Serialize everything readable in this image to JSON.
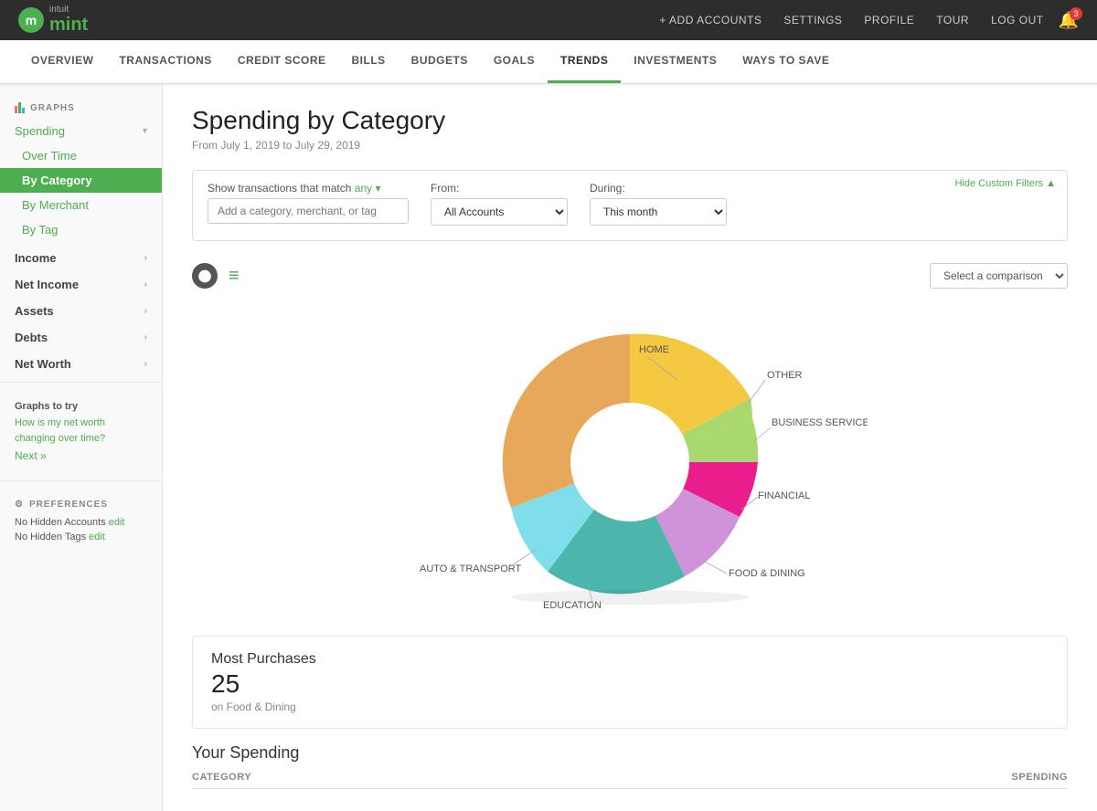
{
  "app": {
    "logo_intuit": "intuit",
    "logo_mint": "mint",
    "bell_count": "3"
  },
  "top_nav": {
    "add_accounts": "+ ADD ACCOUNTS",
    "settings": "SETTINGS",
    "profile": "PROFILE",
    "tour": "TOUR",
    "log_out": "LOG OUT"
  },
  "second_nav": {
    "items": [
      {
        "label": "OVERVIEW",
        "active": false
      },
      {
        "label": "TRANSACTIONS",
        "active": false
      },
      {
        "label": "CREDIT SCORE",
        "active": false
      },
      {
        "label": "BILLS",
        "active": false
      },
      {
        "label": "BUDGETS",
        "active": false
      },
      {
        "label": "GOALS",
        "active": false
      },
      {
        "label": "TRENDS",
        "active": true
      },
      {
        "label": "INVESTMENTS",
        "active": false
      },
      {
        "label": "WAYS TO SAVE",
        "active": false
      }
    ]
  },
  "sidebar": {
    "graphs_label": "GRAPHS",
    "spending_label": "Spending",
    "over_time": "Over Time",
    "by_category": "By Category",
    "by_merchant": "By Merchant",
    "by_tag": "By Tag",
    "income_label": "Income",
    "net_income_label": "Net Income",
    "assets_label": "Assets",
    "debts_label": "Debts",
    "net_worth_label": "Net Worth",
    "graphs_to_try_label": "Graphs to try",
    "graphs_to_try_link": "How is my net worth changing over time?",
    "next_label": "Next »",
    "preferences_label": "PREFERENCES",
    "no_hidden_accounts": "No Hidden Accounts",
    "no_hidden_tags": "No Hidden Tags",
    "edit": "edit"
  },
  "main": {
    "page_title": "Spending by Category",
    "page_subtitle": "From July 1, 2019 to July 29, 2019",
    "filter_label": "Show transactions that match",
    "filter_match": "any",
    "filter_input_placeholder": "Add a category, merchant, or tag",
    "from_label": "From:",
    "from_value": "All Accounts",
    "during_label": "During:",
    "during_value": "This month",
    "hide_filters": "Hide Custom Filters ▲",
    "comparison_placeholder": "Select a comparison",
    "most_purchases_title": "Most Purchases",
    "most_purchases_number": "25",
    "most_purchases_sub": "on Food & Dining",
    "your_spending_title": "Your Spending",
    "category_col": "CATEGORY",
    "spending_col": "SPENDING"
  },
  "chart": {
    "segments": [
      {
        "label": "HOME",
        "color": "#F5C842",
        "percent": 22,
        "startAngle": 0
      },
      {
        "label": "OTHER",
        "color": "#A8D86E",
        "percent": 10,
        "startAngle": 79
      },
      {
        "label": "BUSINESS SERVICES",
        "color": "#E91E8C",
        "percent": 8,
        "startAngle": 115
      },
      {
        "label": "FINANCIAL",
        "color": "#CE93D8",
        "percent": 10,
        "startAngle": 144
      },
      {
        "label": "FOOD & DINING",
        "color": "#4DB6AC",
        "percent": 18,
        "startAngle": 180
      },
      {
        "label": "EDUCATION",
        "color": "#80DEEA",
        "percent": 8,
        "startAngle": 245
      },
      {
        "label": "AUTO & TRANSPORT",
        "color": "#E8A85A",
        "percent": 24,
        "startAngle": 274
      }
    ]
  }
}
